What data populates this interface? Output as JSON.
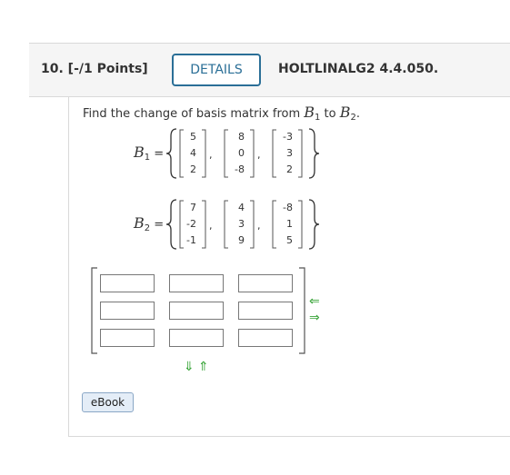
{
  "question": {
    "number_label": "10.  [-/1 Points]",
    "details_label": "DETAILS",
    "code": "HOLTLINALG2 4.4.050."
  },
  "prompt": {
    "text_before": "Find the change of basis matrix from ",
    "b1": "B",
    "b1_sub": "1",
    "text_middle": " to ",
    "b2": "B",
    "b2_sub": "2",
    "text_after": "."
  },
  "set_b1": {
    "label": "B",
    "sub": "1",
    "equals": "=",
    "vectors": [
      [
        "5",
        "4",
        "2"
      ],
      [
        "8",
        "0",
        "-8"
      ],
      [
        "-3",
        "3",
        "2"
      ]
    ]
  },
  "set_b2": {
    "label": "B",
    "sub": "2",
    "equals": "=",
    "vectors": [
      [
        "7",
        "-2",
        "-1"
      ],
      [
        "4",
        "3",
        "9"
      ],
      [
        "-8",
        "1",
        "5"
      ]
    ]
  },
  "answer_matrix": {
    "rows": 3,
    "cols": 3,
    "values": [
      [
        "",
        "",
        ""
      ],
      [
        "",
        "",
        ""
      ],
      [
        "",
        "",
        ""
      ]
    ]
  },
  "controls": {
    "add_column_icon": "left-arrow-icon",
    "remove_column_icon": "right-arrow-icon",
    "remove_row_icon": "down-arrow-icon",
    "add_row_icon": "up-arrow-icon",
    "arrow_color": "#3aa53a",
    "left_arrow": "⇐",
    "right_arrow": "⇒",
    "down_arrow": "⇓",
    "up_arrow": "⇑"
  },
  "ebook": {
    "label": "eBook"
  }
}
